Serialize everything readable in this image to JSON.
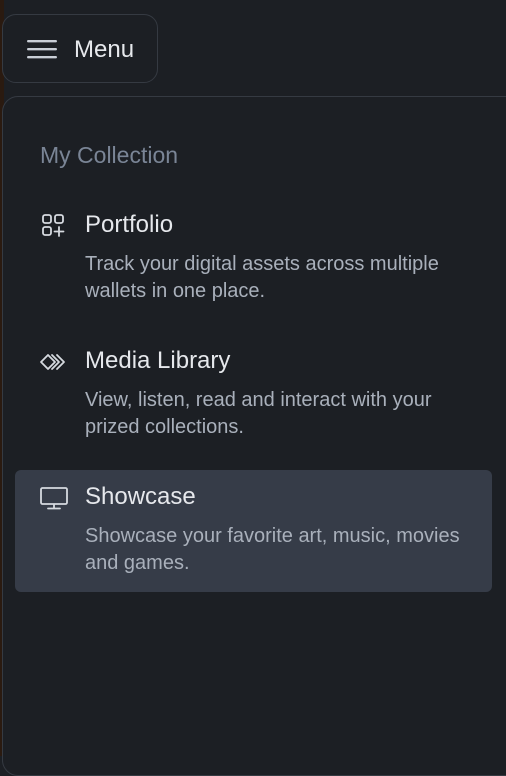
{
  "menu_button": {
    "label": "Menu",
    "icon": "hamburger-icon"
  },
  "panel": {
    "section_title": "My Collection",
    "items": [
      {
        "title": "Portfolio",
        "description": "Track your digital assets across multiple wallets in one place.",
        "icon": "grid-plus-icon",
        "active": false
      },
      {
        "title": "Media Library",
        "description": "View, listen, read and interact with your prized collections.",
        "icon": "layered-diamonds-icon",
        "active": false
      },
      {
        "title": "Showcase",
        "description": "Showcase your favorite art, music, movies and games.",
        "icon": "monitor-icon",
        "active": true
      }
    ]
  },
  "colors": {
    "background": "#1c1f24",
    "border": "#353a42",
    "active_item": "#363c48",
    "title_text": "#e6e8ec",
    "description_text": "#a9b0bb",
    "section_text": "#7a8596"
  }
}
